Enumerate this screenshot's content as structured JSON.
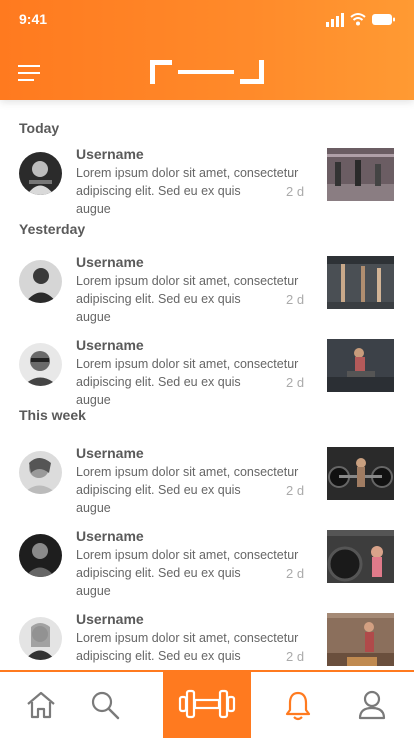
{
  "status_bar": {
    "time": "9:41"
  },
  "header": {
    "logo_icon": "brand-logo-icon",
    "menu_icon": "hamburger-menu-icon"
  },
  "sections": [
    {
      "heading": "Today",
      "items": [
        {
          "username": "Username",
          "line1": "Lorem ipsum dolor sit amet, consectetur",
          "line2": "adipiscing elit. Sed eu ex quis augue",
          "time": "2 d"
        }
      ]
    },
    {
      "heading": "Yesterday",
      "items": [
        {
          "username": "Username",
          "line1": "Lorem ipsum dolor sit amet, consectetur",
          "line2": "adipiscing elit. Sed eu ex quis augue",
          "time": "2 d"
        },
        {
          "username": "Username",
          "line1": "Lorem ipsum dolor sit amet, consectetur",
          "line2": "adipiscing elit. Sed eu ex quis augue",
          "time": "2 d"
        }
      ]
    },
    {
      "heading": "This week",
      "items": [
        {
          "username": "Username",
          "line1": "Lorem ipsum dolor sit amet, consectetur",
          "line2": "adipiscing elit. Sed eu ex quis augue",
          "time": "2 d"
        },
        {
          "username": "Username",
          "line1": "Lorem ipsum dolor sit amet, consectetur",
          "line2": "adipiscing elit. Sed eu ex quis augue",
          "time": "2 d"
        },
        {
          "username": "Username",
          "line1": "Lorem ipsum dolor sit amet, consectetur",
          "line2": "adipiscing elit. Sed eu ex quis augue",
          "time": "2 d"
        }
      ]
    }
  ],
  "bottom_nav": {
    "items": [
      "home-icon",
      "search-icon",
      "dumbbell-icon",
      "bell-icon",
      "profile-icon"
    ],
    "active": "dumbbell-icon"
  },
  "colors": {
    "accent": "#ff7a1f",
    "text": "#5a5a5a",
    "muted": "#aaaaaa"
  }
}
